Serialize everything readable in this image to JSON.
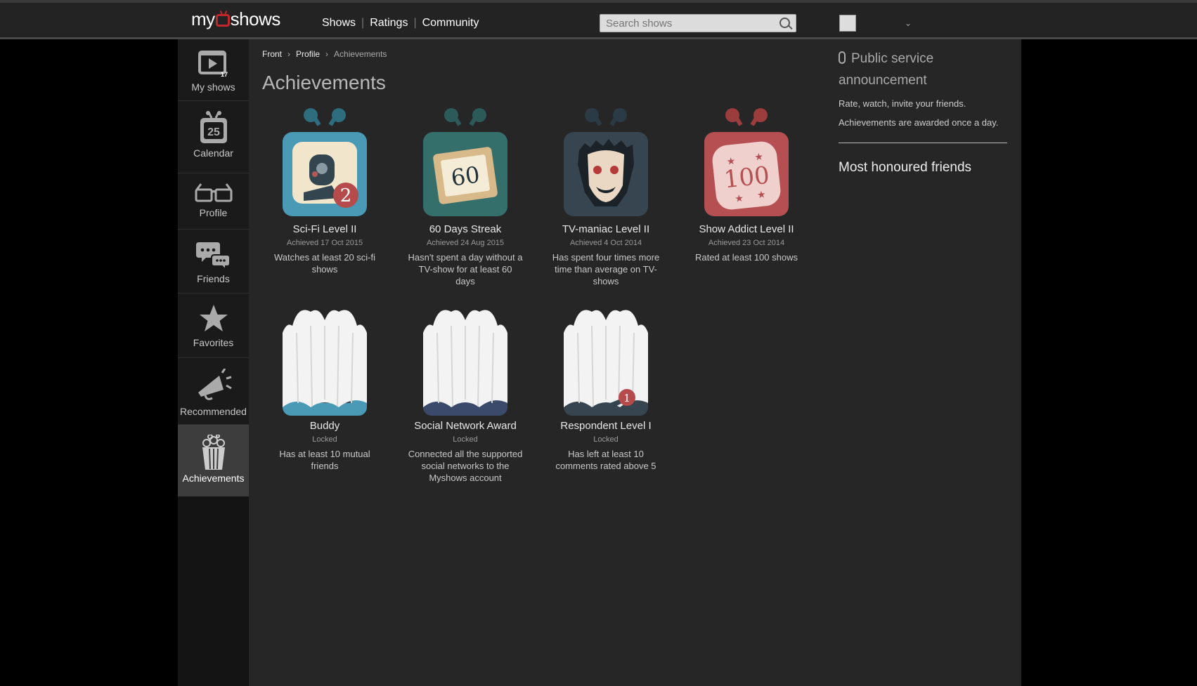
{
  "header": {
    "logo_left": "my",
    "logo_right": "shows",
    "nav": [
      "Shows",
      "Ratings",
      "Community"
    ],
    "search_placeholder": "Search shows"
  },
  "sidebar": {
    "items": [
      {
        "label": "My shows",
        "icon": "clapperboard-icon",
        "badge": "17"
      },
      {
        "label": "Calendar",
        "icon": "calendar-tv-icon",
        "badge": "25"
      },
      {
        "label": "Profile",
        "icon": "3d-glasses-icon"
      },
      {
        "label": "Friends",
        "icon": "chat-bubbles-icon"
      },
      {
        "label": "Favorites",
        "icon": "star-icon"
      },
      {
        "label": "Recommended",
        "icon": "megaphone-icon"
      },
      {
        "label": "Achievements",
        "icon": "popcorn-icon",
        "active": true
      }
    ]
  },
  "breadcrumb": {
    "front": "Front",
    "profile": "Profile",
    "current": "Achievements"
  },
  "page_title": "Achievements",
  "achievements": [
    {
      "name": "Sci-Fi Level II",
      "date": "Achieved 17 Oct 2015",
      "desc": "Watches at least 20 sci-fi shows",
      "number": "2",
      "locked": false
    },
    {
      "name": "60 Days Streak",
      "date": "Achieved 24 Aug 2015",
      "desc": "Hasn't spent a day without a TV-show for at least 60 days",
      "number": "60",
      "locked": false
    },
    {
      "name": "TV-maniac Level II",
      "date": "Achieved 4 Oct 2014",
      "desc": "Has spent four times more time than average on TV-shows",
      "locked": false
    },
    {
      "name": "Show Addict Level II",
      "date": "Achieved 23 Oct 2014",
      "desc": "Rated at least 100 shows",
      "number": "100",
      "locked": false
    },
    {
      "name": "Buddy",
      "date": "Locked",
      "desc": "Has at least 10 mutual friends",
      "locked": true
    },
    {
      "name": "Social Network Award",
      "date": "Locked",
      "desc": "Connected all the supported social networks to the Myshows account",
      "locked": true
    },
    {
      "name": "Respondent Level I",
      "date": "Locked",
      "desc": "Has left at least 10 comments rated above 5",
      "number": "1",
      "locked": true
    }
  ],
  "right_panel": {
    "psa_title": "Public service announcement",
    "line1": "Rate, watch, invite your friends.",
    "line2": "Achievements are awarded once a day.",
    "friends_title": "Most honoured friends"
  }
}
